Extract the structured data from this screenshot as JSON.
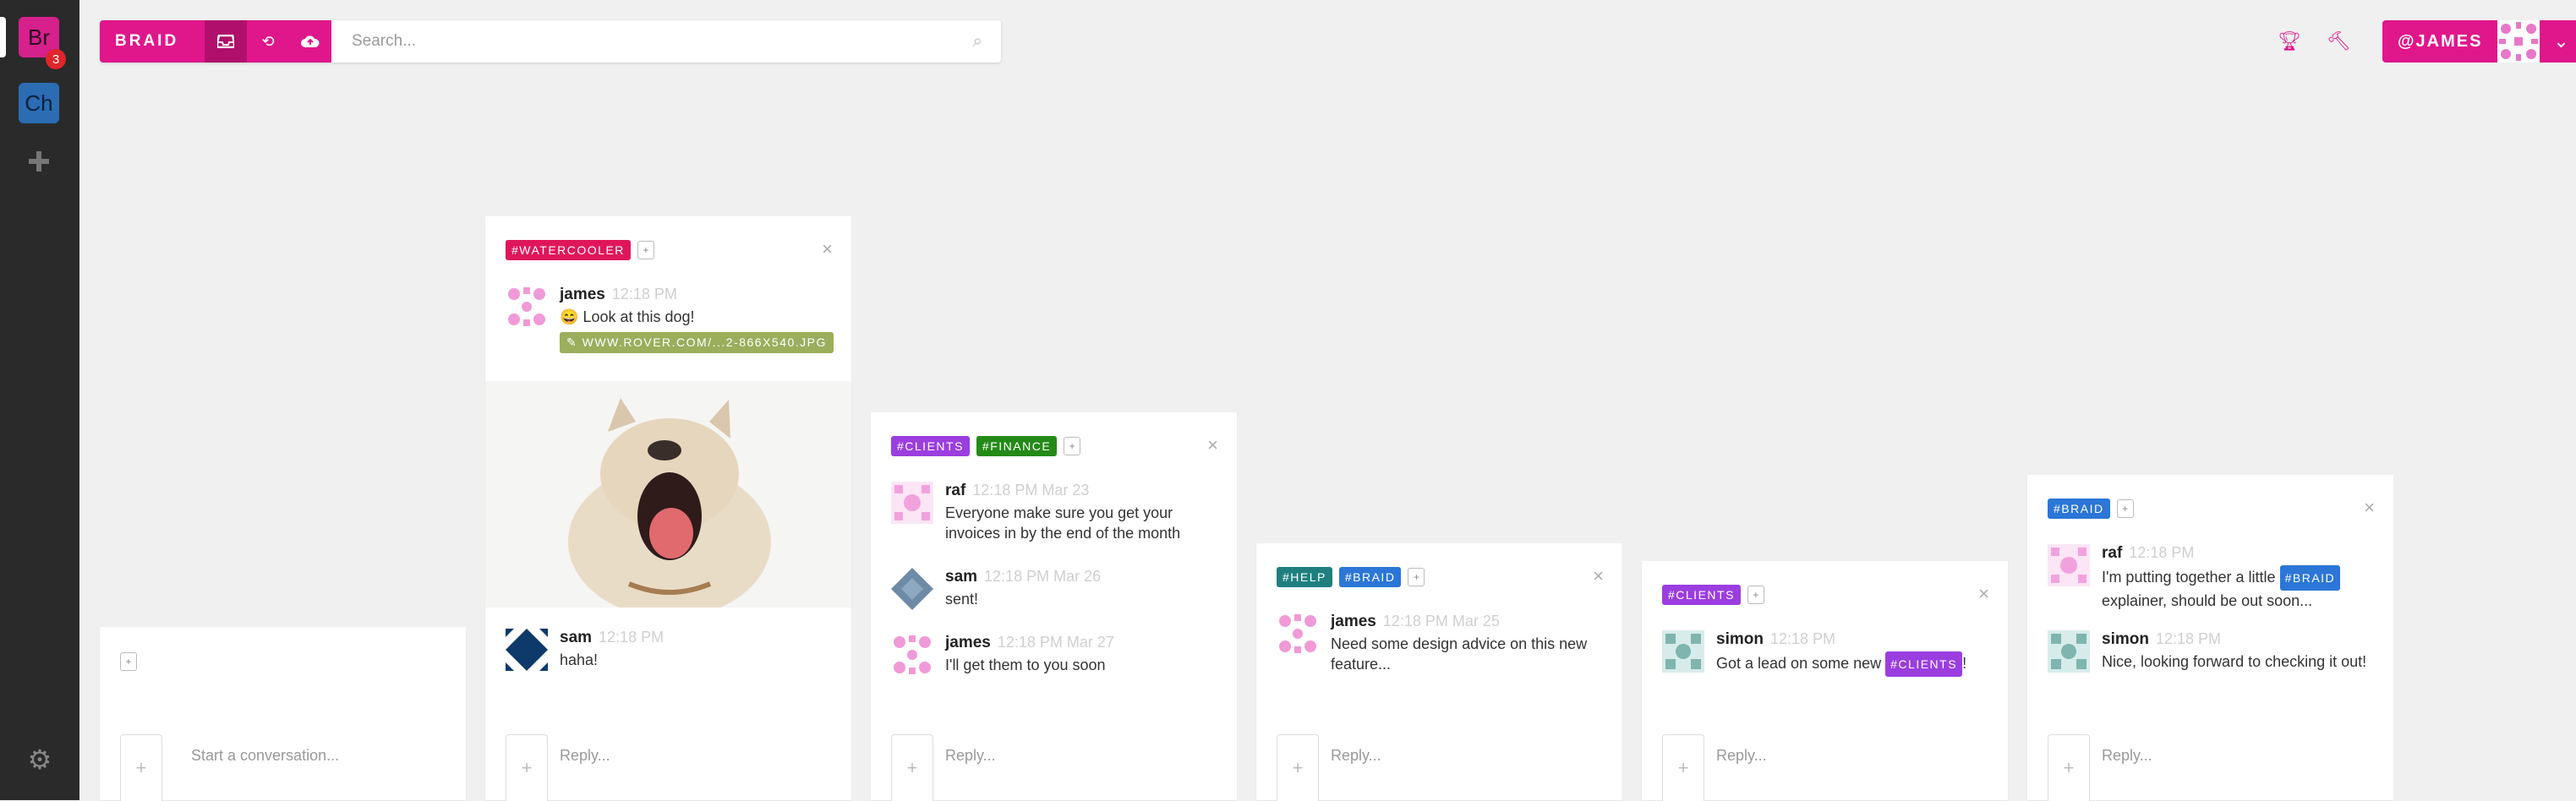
{
  "sidebar": {
    "groups": [
      {
        "abbr": "Br",
        "badge": "3"
      },
      {
        "abbr": "Ch"
      }
    ]
  },
  "topbar": {
    "brand": "BRAID",
    "search_placeholder": "Search...",
    "user": "@JAMES"
  },
  "cards": [
    {
      "tags": [],
      "messages": [],
      "reply_placeholder": "Start a conversation..."
    },
    {
      "tags": [
        "#WATERCOOLER"
      ],
      "messages": [
        {
          "user": "james",
          "time": "12:18 PM",
          "text": "Look at this dog!",
          "link": "✎ WWW.ROVER.COM/...2-866X540.JPG"
        },
        {
          "user": "sam",
          "time": "12:18 PM",
          "text": "haha!"
        }
      ],
      "reply_placeholder": "Reply..."
    },
    {
      "tags": [
        "#CLIENTS",
        "#FINANCE"
      ],
      "messages": [
        {
          "user": "raf",
          "time": "12:18 PM Mar 23",
          "text": "Everyone make sure you get your invoices in by the end of the month"
        },
        {
          "user": "sam",
          "time": "12:18 PM Mar 26",
          "text": "sent!"
        },
        {
          "user": "james",
          "time": "12:18 PM Mar 27",
          "text": "I'll get them to you soon"
        }
      ],
      "reply_placeholder": "Reply..."
    },
    {
      "tags": [
        "#HELP",
        "#BRAID"
      ],
      "messages": [
        {
          "user": "james",
          "time": "12:18 PM Mar 25",
          "text": "Need some design advice on this new feature..."
        }
      ],
      "reply_placeholder": "Reply..."
    },
    {
      "tags": [
        "#CLIENTS"
      ],
      "messages": [
        {
          "user": "simon",
          "time": "12:18 PM",
          "text_before": "Got a lead on some new",
          "inline_tag": "#CLIENTS",
          "text_after": "!"
        }
      ],
      "reply_placeholder": "Reply..."
    },
    {
      "tags": [
        "#BRAID"
      ],
      "messages": [
        {
          "user": "raf",
          "time": "12:18 PM",
          "text_before": "I'm putting together a little",
          "inline_tag": "#BRAID",
          "text_after": "explainer, should be out soon..."
        },
        {
          "user": "simon",
          "time": "12:18 PM",
          "text": "Nice, looking forward to checking it out!"
        }
      ],
      "reply_placeholder": "Reply..."
    }
  ],
  "colors": {
    "brand": "#e0168b",
    "watercooler": "#e0165a",
    "clients": "#9b3ee0",
    "finance": "#248a17",
    "help": "#1f7f7f",
    "braid": "#2b76d6"
  }
}
